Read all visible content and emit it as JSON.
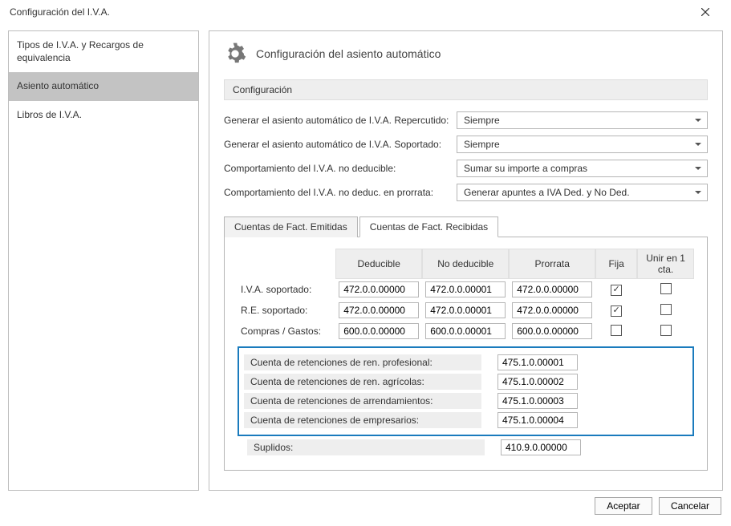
{
  "window": {
    "title": "Configuración del I.V.A."
  },
  "sidebar": {
    "items": [
      {
        "label": "Tipos de I.V.A. y Recargos de equivalencia",
        "active": false
      },
      {
        "label": "Asiento automático",
        "active": true
      },
      {
        "label": "Libros de I.V.A.",
        "active": false
      }
    ]
  },
  "main": {
    "heading": "Configuración del asiento automático",
    "config_label": "Configuración",
    "fields": [
      {
        "label": "Generar el asiento automático de I.V.A. Repercutido:",
        "value": "Siempre"
      },
      {
        "label": "Generar el asiento automático de I.V.A. Soportado:",
        "value": "Siempre"
      },
      {
        "label": "Comportamiento del I.V.A. no deducible:",
        "value": "Sumar su importe a compras"
      },
      {
        "label": "Comportamiento del I.V.A. no deduc. en prorrata:",
        "value": "Generar apuntes a IVA Ded. y No Ded."
      }
    ],
    "tabs": [
      {
        "label": "Cuentas de Fact. Emitidas",
        "active": false
      },
      {
        "label": "Cuentas de Fact. Recibidas",
        "active": true
      }
    ],
    "table": {
      "headers": {
        "deducible": "Deducible",
        "no_deducible": "No deducible",
        "prorrata": "Prorrata",
        "fija": "Fija",
        "unir": "Unir en 1 cta."
      },
      "rows": [
        {
          "label": "I.V.A. soportado:",
          "ded": "472.0.0.00000",
          "noded": "472.0.0.00001",
          "pro": "472.0.0.00000",
          "fija": true,
          "unir": false
        },
        {
          "label": "R.E. soportado:",
          "ded": "472.0.0.00000",
          "noded": "472.0.0.00001",
          "pro": "472.0.0.00000",
          "fija": true,
          "unir": false
        },
        {
          "label": "Compras / Gastos:",
          "ded": "600.0.0.00000",
          "noded": "600.0.0.00001",
          "pro": "600.0.0.00000",
          "fija": false,
          "unir": false
        }
      ]
    },
    "retenciones": [
      {
        "label": "Cuenta de retenciones de ren. profesional:",
        "value": "475.1.0.00001"
      },
      {
        "label": "Cuenta de retenciones de ren. agrícolas:",
        "value": "475.1.0.00002"
      },
      {
        "label": "Cuenta de retenciones de arrendamientos:",
        "value": "475.1.0.00003"
      },
      {
        "label": "Cuenta de retenciones de empresarios:",
        "value": "475.1.0.00004"
      }
    ],
    "suplidos": {
      "label": "Suplidos:",
      "value": "410.9.0.00000"
    }
  },
  "footer": {
    "accept": "Aceptar",
    "cancel": "Cancelar"
  }
}
